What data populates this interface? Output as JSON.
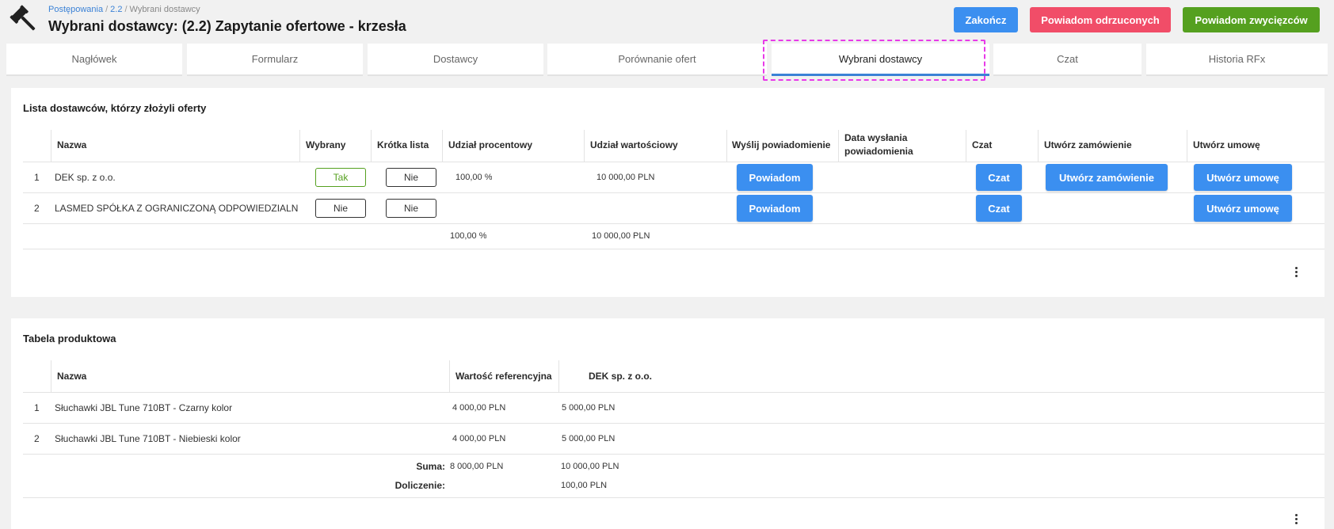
{
  "breadcrumb": {
    "items": [
      "Postępowania",
      "2.2",
      "Wybrani dostawcy"
    ],
    "separator": "/"
  },
  "title": "Wybrani dostawcy: (2.2) Zapytanie ofertowe - krzesła",
  "actions": {
    "finish": "Zakończ",
    "notify_rejected": "Powiadom odrzuconych",
    "notify_winners": "Powiadom zwycięzców"
  },
  "tabs": [
    {
      "label": "Nagłówek"
    },
    {
      "label": "Formularz"
    },
    {
      "label": "Dostawcy"
    },
    {
      "label": "Porównanie ofert"
    },
    {
      "label": "Wybrani dostawcy",
      "active": true
    },
    {
      "label": "Czat"
    },
    {
      "label": "Historia RFx"
    }
  ],
  "suppliers": {
    "title": "Lista dostawców, którzy złożyli oferty",
    "columns": {
      "name": "Nazwa",
      "selected": "Wybrany",
      "shortlist": "Krótka lista",
      "share_pct": "Udział procentowy",
      "share_value": "Udział wartościowy",
      "notify": "Wyślij powiadomienie",
      "notify_date": "Data wysłania powiadomienia",
      "chat": "Czat",
      "order": "Utwórz zamówienie",
      "contract": "Utwórz umowę"
    },
    "rows": [
      {
        "no": "1",
        "name": "DEK sp. z o.o.",
        "selected": "Tak",
        "shortlist": "Nie",
        "share_pct": "100,00 %",
        "share_value": "10 000,00 PLN",
        "notify": "Powiadom",
        "chat": "Czat",
        "order": "Utwórz zamówienie",
        "contract": "Utwórz umowę"
      },
      {
        "no": "2",
        "name": "LASMED SPÓŁKA Z OGRANICZONĄ ODPOWIEDZIALNOŚCIĄ",
        "selected": "Nie",
        "shortlist": "Nie",
        "share_pct": "",
        "share_value": "",
        "notify": "Powiadom",
        "chat": "Czat",
        "order": "",
        "contract": "Utwórz umowę"
      }
    ],
    "totals": {
      "share_pct": "100,00 %",
      "share_value": "10 000,00 PLN"
    }
  },
  "products": {
    "title": "Tabela produktowa",
    "columns": {
      "name": "Nazwa",
      "ref_value": "Wartość referencyjna",
      "supplier": "DEK sp. z o.o."
    },
    "rows": [
      {
        "no": "1",
        "name": "Słuchawki JBL Tune 710BT - Czarny kolor",
        "ref_value": "4 000,00 PLN",
        "supplier_value": "5 000,00 PLN"
      },
      {
        "no": "2",
        "name": "Słuchawki JBL Tune 710BT - Niebieski kolor",
        "ref_value": "4 000,00 PLN",
        "supplier_value": "5 000,00 PLN"
      }
    ],
    "sum": {
      "label": "Suma:",
      "ref_value": "8 000,00 PLN",
      "supplier_value": "10 000,00 PLN"
    },
    "extra": {
      "label": "Doliczenie:",
      "supplier_value": "100,00 PLN"
    }
  },
  "icons": {
    "logo": "gavel-icon",
    "more": "more-vertical-icon"
  },
  "colors": {
    "primary": "#3b8ff0",
    "danger": "#f14d68",
    "success": "#55a01f",
    "link": "#3b82d6",
    "highlight": "#e83ae8"
  }
}
